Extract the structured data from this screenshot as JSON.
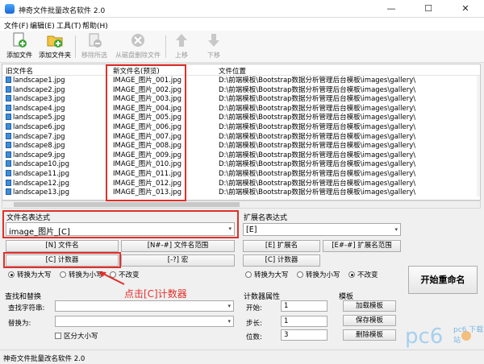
{
  "window": {
    "title": "神奇文件批量改名软件 2.0",
    "min": "—",
    "max": "☐",
    "close": "✕"
  },
  "menu": [
    "文件(F)",
    "编辑(E)",
    "工具(T)",
    "帮助(H)"
  ],
  "toolbar": [
    {
      "label": "添加文件",
      "icon": "add-file-icon",
      "enabled": true
    },
    {
      "label": "添加文件夹",
      "icon": "add-folder-icon",
      "enabled": true
    },
    {
      "label": "移除所选",
      "icon": "remove-selected-icon",
      "enabled": false
    },
    {
      "label": "从磁盘删除文件",
      "icon": "delete-from-disk-icon",
      "enabled": false
    },
    {
      "label": "上移",
      "icon": "arrow-up-icon",
      "enabled": false
    },
    {
      "label": "下移",
      "icon": "arrow-down-icon",
      "enabled": false
    }
  ],
  "grid": {
    "headers": [
      "旧文件名",
      "新文件名(预览)",
      "文件位置"
    ],
    "rows": [
      [
        "landscape1.jpg",
        "IMAGE_图片_001.jpg",
        "D:\\前端模板\\Bootstrap数据分析管理后台模板\\images\\gallery\\"
      ],
      [
        "landscape2.jpg",
        "IMAGE_图片_002.jpg",
        "D:\\前端模板\\Bootstrap数据分析管理后台模板\\images\\gallery\\"
      ],
      [
        "landscape3.jpg",
        "IMAGE_图片_003.jpg",
        "D:\\前端模板\\Bootstrap数据分析管理后台模板\\images\\gallery\\"
      ],
      [
        "landscape4.jpg",
        "IMAGE_图片_004.jpg",
        "D:\\前端模板\\Bootstrap数据分析管理后台模板\\images\\gallery\\"
      ],
      [
        "landscape5.jpg",
        "IMAGE_图片_005.jpg",
        "D:\\前端模板\\Bootstrap数据分析管理后台模板\\images\\gallery\\"
      ],
      [
        "landscape6.jpg",
        "IMAGE_图片_006.jpg",
        "D:\\前端模板\\Bootstrap数据分析管理后台模板\\images\\gallery\\"
      ],
      [
        "landscape7.jpg",
        "IMAGE_图片_007.jpg",
        "D:\\前端模板\\Bootstrap数据分析管理后台模板\\images\\gallery\\"
      ],
      [
        "landscape8.jpg",
        "IMAGE_图片_008.jpg",
        "D:\\前端模板\\Bootstrap数据分析管理后台模板\\images\\gallery\\"
      ],
      [
        "landscape9.jpg",
        "IMAGE_图片_009.jpg",
        "D:\\前端模板\\Bootstrap数据分析管理后台模板\\images\\gallery\\"
      ],
      [
        "landscape10.jpg",
        "IMAGE_图片_010.jpg",
        "D:\\前端模板\\Bootstrap数据分析管理后台模板\\images\\gallery\\"
      ],
      [
        "landscape11.jpg",
        "IMAGE_图片_011.jpg",
        "D:\\前端模板\\Bootstrap数据分析管理后台模板\\images\\gallery\\"
      ],
      [
        "landscape12.jpg",
        "IMAGE_图片_012.jpg",
        "D:\\前端模板\\Bootstrap数据分析管理后台模板\\images\\gallery\\"
      ],
      [
        "landscape13.jpg",
        "IMAGE_图片_013.jpg",
        "D:\\前端模板\\Bootstrap数据分析管理后台模板\\images\\gallery\\"
      ]
    ]
  },
  "filename_expr": {
    "label": "文件名表达式",
    "value": "image_图片_[C]",
    "buttons": [
      "[N] 文件名",
      "[N#-#] 文件名范围",
      "[C] 计数器",
      "[-?] 宏"
    ],
    "case_options": [
      "转换为大写",
      "转换为小写",
      "不改变"
    ],
    "case_selected": 0
  },
  "ext_expr": {
    "label": "扩展名表达式",
    "value": "[E]",
    "buttons": [
      "[E] 扩展名",
      "[E#-#] 扩展名范围",
      "[C] 计数器"
    ],
    "case_options": [
      "转换为大写",
      "转换为小写",
      "不改变"
    ],
    "case_selected": 2
  },
  "start_button": "开始重命名",
  "annotation": "点击[C]计数器",
  "find_replace": {
    "title": "查找和替换",
    "find_label": "查找字符串:",
    "replace_label": "替换为:",
    "case_label": "区分大小写",
    "find_value": "",
    "replace_value": ""
  },
  "counter": {
    "title": "计数器属性",
    "start_label": "开始:",
    "start": "1",
    "step_label": "步长:",
    "step": "1",
    "digits_label": "位数:",
    "digits": "3"
  },
  "template": {
    "title": "模板",
    "buttons": [
      "加载模板",
      "保存模板",
      "删除模板"
    ]
  },
  "status": "神奇文件批量改名软件 2.0",
  "watermark": "pc6 下载站",
  "colors": {
    "highlight": "#e0302a",
    "accent": "#1c67d6"
  }
}
